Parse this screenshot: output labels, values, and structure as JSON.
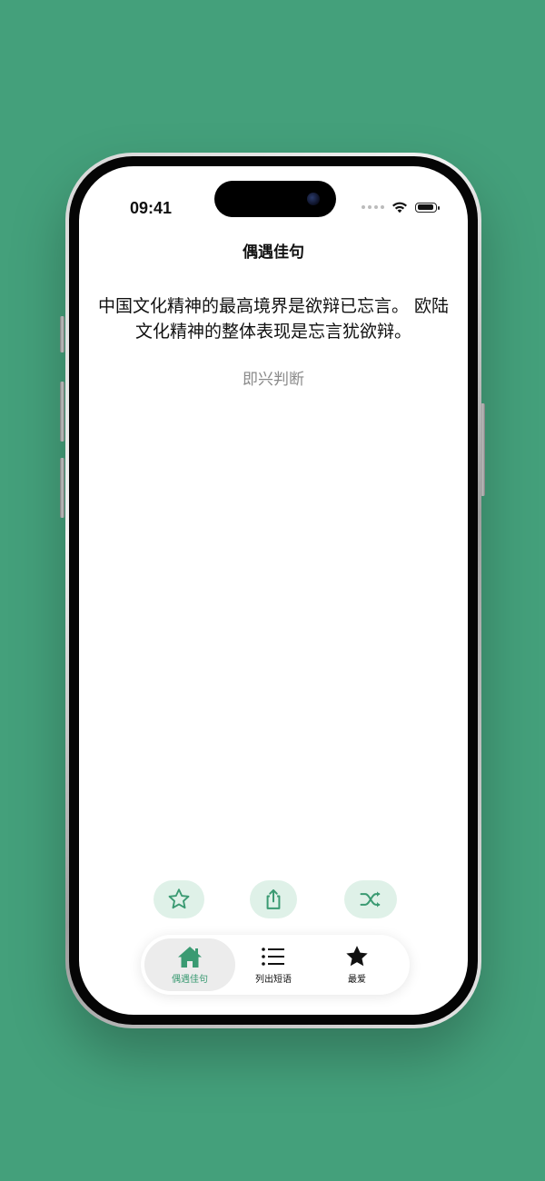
{
  "status_bar": {
    "time": "09:41"
  },
  "nav": {
    "title": "偶遇佳句"
  },
  "quote": {
    "text": "中国文化精神的最高境界是欲辩已忘言。 欧陆文化精神的整体表现是忘言犹欲辩。",
    "author": "即兴判断"
  },
  "actions": [
    {
      "icon": "star-outline-icon"
    },
    {
      "icon": "share-icon"
    },
    {
      "icon": "shuffle-icon"
    }
  ],
  "tabs": [
    {
      "label": "偶遇佳句",
      "icon": "house-icon",
      "active": true
    },
    {
      "label": "列出短语",
      "icon": "list-icon",
      "active": false
    },
    {
      "label": "最爱",
      "icon": "star-filled-icon",
      "active": false
    }
  ],
  "colors": {
    "background": "#44a07b",
    "accent": "#3a9a72",
    "action_button_bg": "#dff1e8",
    "active_tab_bg": "#ececec"
  }
}
